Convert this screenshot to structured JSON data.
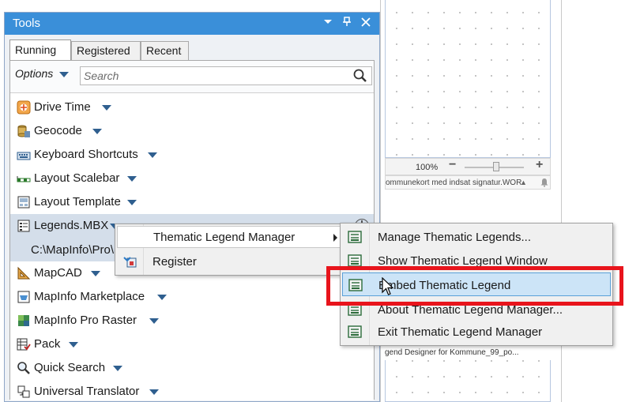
{
  "background_window": {
    "zoom_label": "100%",
    "zoom_minus": "−",
    "zoom_plus": "+",
    "status_text": "ommunekort med indsat signatur.WOR",
    "status_arrow": "▲",
    "doc_tab_text": "gend Designer for Kommune_99_po..."
  },
  "panel": {
    "title": "Tools",
    "tabs": [
      "Running",
      "Registered",
      "Recent"
    ],
    "options_label": "Options",
    "search_placeholder": "Search"
  },
  "tools": [
    {
      "label": "Drive Time",
      "icon": "drive-time-icon"
    },
    {
      "label": "Geocode",
      "icon": "geocode-icon"
    },
    {
      "label": "Keyboard Shortcuts",
      "icon": "keyboard-icon"
    },
    {
      "label": "Layout Scalebar",
      "icon": "scalebar-icon"
    },
    {
      "label": "Layout Template",
      "icon": "layout-template-icon"
    },
    {
      "label": "Legends.MBX",
      "icon": "legends-icon"
    },
    {
      "label": "C:\\MapInfo\\Pro\\",
      "icon": ""
    },
    {
      "label": "MapCAD",
      "icon": "mapcad-icon"
    },
    {
      "label": "MapInfo Marketplace",
      "icon": "marketplace-icon"
    },
    {
      "label": "MapInfo Pro Raster",
      "icon": "raster-icon"
    },
    {
      "label": "Pack",
      "icon": "pack-icon"
    },
    {
      "label": "Quick Search",
      "icon": "quick-search-icon"
    },
    {
      "label": "Universal Translator",
      "icon": "translator-icon"
    }
  ],
  "context_menu": {
    "items": [
      {
        "label": "Thematic Legend Manager",
        "has_submenu": true
      },
      {
        "label": "Register",
        "has_submenu": false
      }
    ]
  },
  "submenu": {
    "items": [
      {
        "label": "Manage Thematic Legends..."
      },
      {
        "label": "Show Thematic Legend Window"
      },
      {
        "label": "Embed Thematic Legend"
      },
      {
        "label": "About Thematic Legend Manager..."
      },
      {
        "label": "Exit Thematic Legend Manager"
      }
    ]
  },
  "colors": {
    "title_bar": "#3a8fd9",
    "selection": "#d4deea",
    "menu_hover": "#cce4f7",
    "highlight_box": "#e8141c"
  }
}
